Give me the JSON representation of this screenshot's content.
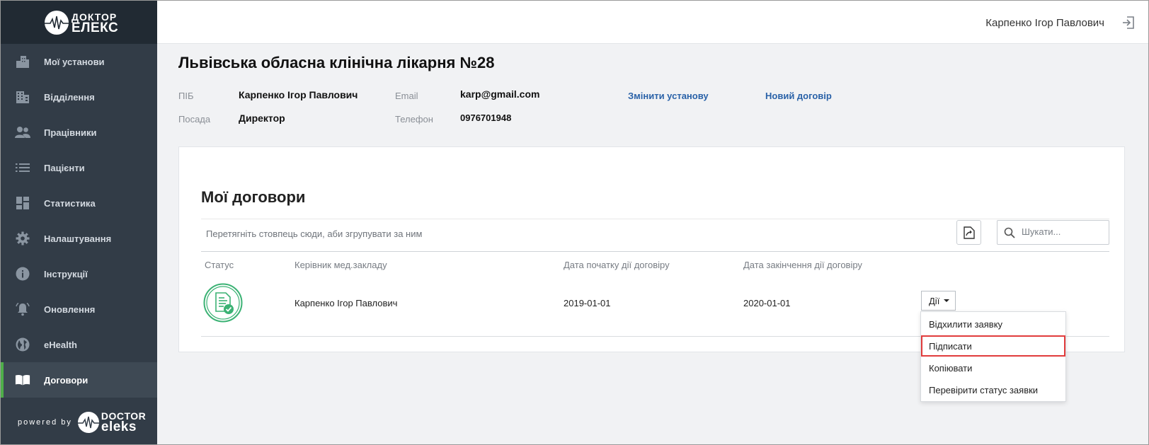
{
  "app": {
    "logo_line1": "ДОКТОР",
    "logo_line2": "ЕЛЕКС",
    "powered_by": "powered by",
    "powered_brand_line1": "DOCTOR",
    "powered_brand_line2": "eleks"
  },
  "sidebar": {
    "items": [
      {
        "label": "Мої установи",
        "icon": "building-icon"
      },
      {
        "label": "Відділення",
        "icon": "office-icon"
      },
      {
        "label": "Працівники",
        "icon": "people-icon"
      },
      {
        "label": "Пацієнти",
        "icon": "list-icon"
      },
      {
        "label": "Статистика",
        "icon": "dashboard-icon"
      },
      {
        "label": "Налаштування",
        "icon": "gear-icon"
      },
      {
        "label": "Інструкції",
        "icon": "info-icon"
      },
      {
        "label": "Оновлення",
        "icon": "bell-icon"
      },
      {
        "label": "eHealth",
        "icon": "globe-icon"
      },
      {
        "label": "Договори",
        "icon": "book-icon",
        "active": true
      }
    ]
  },
  "header": {
    "user_name": "Карпенко Ігор Павлович",
    "logout_icon": "logout-icon"
  },
  "institution": {
    "title": "Львівська обласна клінічна лікарня №28",
    "pib_label": "ПІБ",
    "pib_value": "Карпенко Ігор Павлович",
    "position_label": "Посада",
    "position_value": "Директор",
    "email_label": "Email",
    "email_value": "karp@gmail.com",
    "phone_label": "Телефон",
    "phone_value": "0976701948",
    "change_link": "Змінити установу",
    "new_contract_link": "Новий договір"
  },
  "contracts": {
    "title": "Мої договори",
    "group_hint": "Перетягніть стовпець сюди, аби згрупувати за ним",
    "search_placeholder": "Шукати...",
    "columns": [
      "Статус",
      "Керівник мед.закладу",
      "Дата початку дії договіру",
      "Дата закінчення дії договіру"
    ],
    "rows": [
      {
        "status_icon": "signed-document-icon",
        "manager": "Карпенко Ігор Павлович",
        "start": "2019-01-01",
        "end": "2020-01-01",
        "actions_label": "Дії"
      }
    ],
    "actions_menu": [
      "Відхилити заявку",
      "Підписати",
      "Копіювати",
      "Перевірити статус заявки"
    ],
    "highlighted_action": "Підписати"
  },
  "colors": {
    "sidebar_bg": "#323c47",
    "sidebar_logo_bg": "#212a33",
    "active_accent": "#4fae4a",
    "link": "#2a62a8",
    "highlight_border": "#e13c3c",
    "status_green": "#3bb274"
  }
}
